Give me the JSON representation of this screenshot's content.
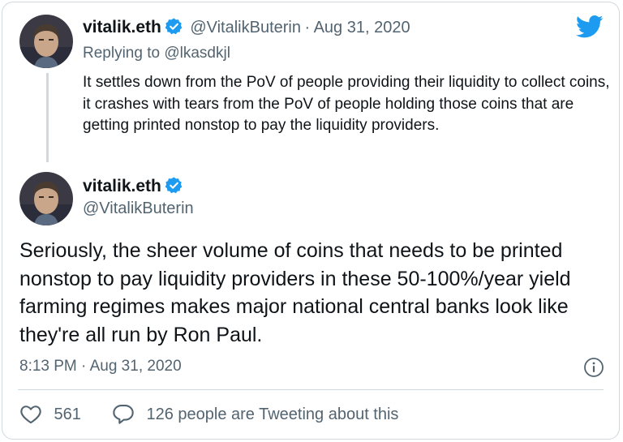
{
  "parent_tweet": {
    "name": "vitalik.eth",
    "handle": "@VitalikButerin",
    "separator": "·",
    "date": "Aug 31, 2020",
    "replying_to_prefix": "Replying to ",
    "replying_to_handle": "@lkasdkjl",
    "text": "It settles down from the PoV of people providing their liquidity to collect coins, it crashes with tears from the PoV of people holding those coins that are getting printed nonstop to pay the liquidity providers."
  },
  "main_tweet": {
    "name": "vitalik.eth",
    "handle": "@VitalikButerin",
    "text": "Seriously, the sheer volume of coins that needs to be printed nonstop to pay liquidity providers in these 50-100%/year yield farming regimes makes major national central banks look like they're all run by Ron Paul.",
    "timestamp": "8:13 PM · Aug 31, 2020"
  },
  "actions": {
    "likes": "561",
    "conversation": "126 people are Tweeting about this"
  },
  "icons": {
    "brand": "twitter-bird-icon",
    "verified": "verified-badge-icon",
    "info": "info-icon",
    "like": "heart-icon",
    "reply": "speech-bubble-icon"
  },
  "colors": {
    "brand_blue": "#1d9bf0",
    "secondary_text": "#536471",
    "primary_text": "#0f1419",
    "border": "#cfd9de"
  }
}
